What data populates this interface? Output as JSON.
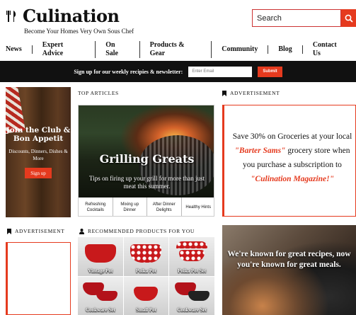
{
  "header": {
    "logo_text": "Culination",
    "tagline": "Become Your Homes Very Own Sous Chef",
    "search_placeholder": "Search"
  },
  "nav": [
    "News",
    "Expert Advice",
    "On Sale",
    "Products & Gear",
    "Community",
    "Blog",
    "Contact Us"
  ],
  "newsletter": {
    "label": "Sign up for our weekly recipies & newsletter:",
    "placeholder": "Enter Email",
    "submit": "Submit"
  },
  "club": {
    "title": "Join the Club & Bon Appetit",
    "subtitle": "Discounts, Dinners, Dishes & More",
    "button": "Sign up"
  },
  "top_articles": {
    "heading": "TOP ARTICLES",
    "title": "Grilling Greats",
    "description": "Tips on firing up your grill for more than just meat this summer.",
    "tabs": [
      "Refreshing Cocktails",
      "Mixing up Dinner",
      "After Dinner Delights",
      "Healthy Hints"
    ]
  },
  "advertisement": {
    "heading": "ADVERTISEMENT",
    "line1": "Save 30% on Groceries at your local",
    "store": "\"Barter Sams\"",
    "line2": "grocery store when you purchase a subscription to",
    "magazine": "\"Culination Magazine!\""
  },
  "advertisement_small": {
    "heading": "ADVERTISEMENT"
  },
  "products": {
    "heading": "RECOMMENDED PRODUCTS FOR YOU",
    "items": [
      "Vintage Pot",
      "Polka Pot",
      "Polka Pot Set",
      "Cookware Set",
      "Small Pot",
      "Cookware Set"
    ]
  },
  "promo": {
    "text": "We're known for great recipes, now you're known for great meals."
  },
  "colors": {
    "accent": "#e53a1e",
    "bar": "#111111"
  }
}
